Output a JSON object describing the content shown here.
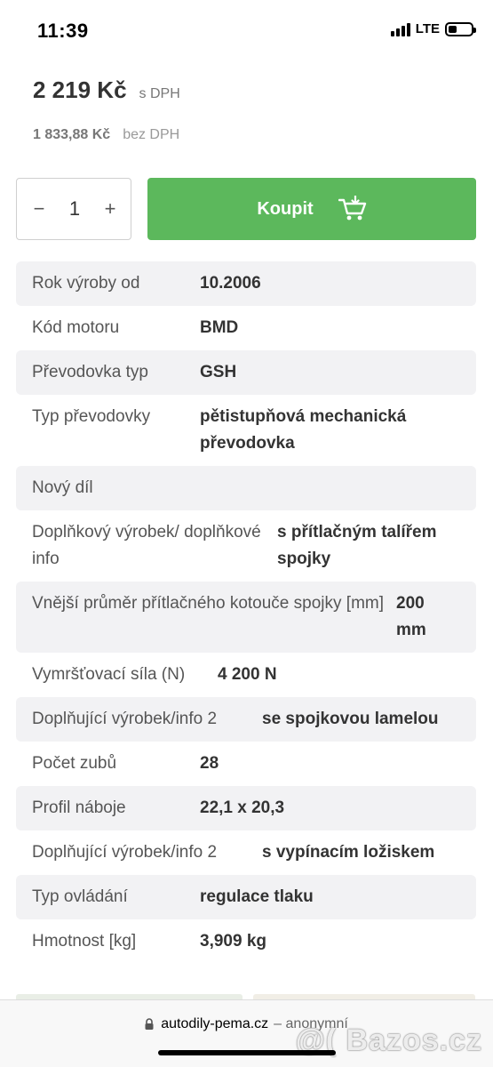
{
  "status": {
    "time": "11:39",
    "network": "LTE"
  },
  "price": {
    "with_vat": "2 219 Kč",
    "with_vat_note": "s DPH",
    "without_vat": "1 833,88 Kč",
    "without_vat_note": "bez DPH"
  },
  "cart": {
    "minus": "−",
    "quantity": "1",
    "plus": "+",
    "buy_label": "Koupit"
  },
  "specs": [
    {
      "label": "Rok výroby od",
      "value": "10.2006"
    },
    {
      "label": "Kód motoru",
      "value": "BMD"
    },
    {
      "label": "Převodovka typ",
      "value": "GSH"
    },
    {
      "label": "Typ převodovky",
      "value": "pětistupňová mechanická převodovka"
    },
    {
      "label": "Nový díl",
      "value": ""
    },
    {
      "label": "Doplňkový výrobek/ doplňkové info",
      "value": "s přítlačným talířem spojky"
    },
    {
      "label": "Vnější průměr přítlačného kotouče spojky [mm]",
      "value": "200 mm"
    },
    {
      "label": "Vymršťovací síla (N)",
      "value": "4 200 N"
    },
    {
      "label": "Doplňující výrobek/info 2",
      "value": "se spojkovou lamelou"
    },
    {
      "label": "Počet zubů",
      "value": "28"
    },
    {
      "label": "Profil náboje",
      "value": "22,1 x 20,3"
    },
    {
      "label": "Doplňující výrobek/info 2",
      "value": "s vypínacím ložiskem"
    },
    {
      "label": "Typ ovládání",
      "value": "regulace tlaku"
    },
    {
      "label": "Hmotnost [kg]",
      "value": "3,909 kg"
    }
  ],
  "browser": {
    "host": "autodily-pema.cz",
    "mode": "– anonymní"
  },
  "watermark": "@( Bazos.cz",
  "colors": {
    "buy_button": "#5cb85c",
    "row_shade": "#f2f2f4"
  }
}
